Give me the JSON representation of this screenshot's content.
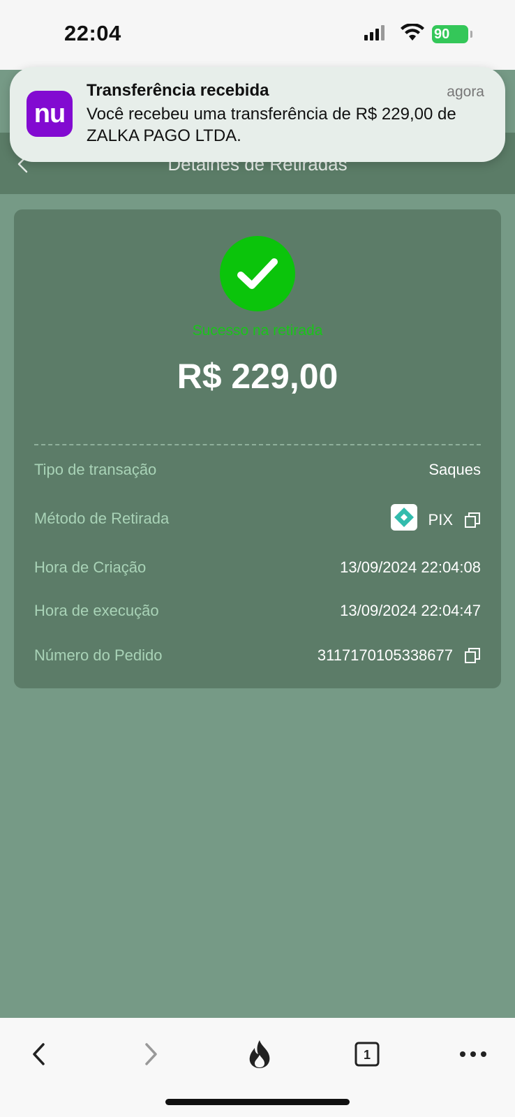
{
  "status_bar": {
    "time": "22:04",
    "battery": "90"
  },
  "header": {
    "title": "Detalhes de Retiradas"
  },
  "notification": {
    "app_logo_text": "nu",
    "title": "Transferência recebida",
    "time": "agora",
    "body": "Você recebeu uma transferência de R$ 229,00 de ZALKA PAGO LTDA."
  },
  "detail": {
    "status": "Sucesso na retirada",
    "amount": "R$ 229,00",
    "rows": [
      {
        "label": "Tipo de transação",
        "value": "Saques"
      },
      {
        "label": "Método de Retirada",
        "value": "PIX"
      },
      {
        "label": "Hora de Criação",
        "value": "13/09/2024 22:04:08"
      },
      {
        "label": "Hora de execução",
        "value": "13/09/2024 22:04:47"
      },
      {
        "label": "Número do Pedido",
        "value": "3117170105338677"
      }
    ]
  },
  "toolbar": {
    "tabs_count": "1"
  },
  "colors": {
    "background": "#769A86",
    "card": "#5C7C68",
    "header": "#5B7C67",
    "success": "#0BC40B",
    "label": "#A9D3B7",
    "nubank_purple": "#820AD1",
    "pix_teal": "#32BCAD"
  },
  "icons": [
    "back-icon",
    "check-icon",
    "pix-icon",
    "copy-icon",
    "chevron-left-icon",
    "chevron-right-icon",
    "flame-icon",
    "tabs-icon",
    "more-icon"
  ]
}
